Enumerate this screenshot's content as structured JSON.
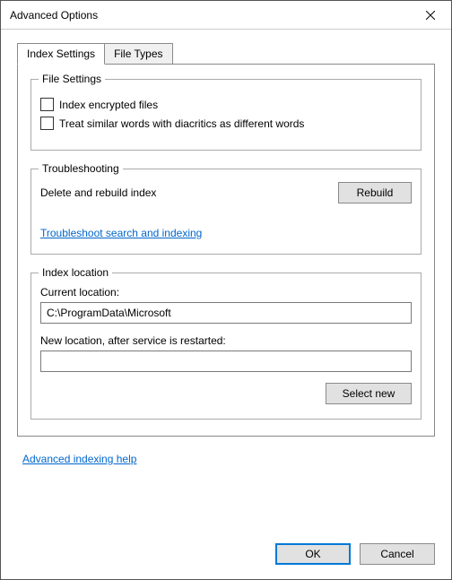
{
  "window": {
    "title": "Advanced Options"
  },
  "tabs": {
    "active": "Index Settings",
    "other": "File Types"
  },
  "fileSettings": {
    "legend": "File Settings",
    "opt1": "Index encrypted files",
    "opt2": "Treat similar words with diacritics as different words"
  },
  "troubleshooting": {
    "legend": "Troubleshooting",
    "rebuildText": "Delete and rebuild index",
    "rebuildBtn": "Rebuild",
    "link": "Troubleshoot search and indexing"
  },
  "indexLocation": {
    "legend": "Index location",
    "currentLabel": "Current location:",
    "currentValue": "C:\\ProgramData\\Microsoft",
    "newLabel": "New location, after service is restarted:",
    "newValue": "",
    "selectBtn": "Select new"
  },
  "helpLink": "Advanced indexing help",
  "footer": {
    "ok": "OK",
    "cancel": "Cancel"
  }
}
